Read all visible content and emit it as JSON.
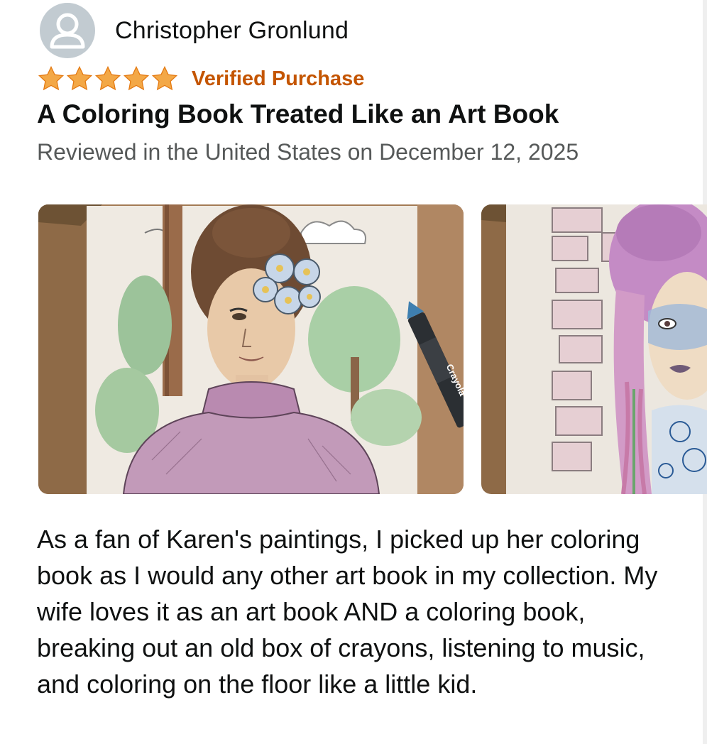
{
  "reviewer": {
    "name": "Christopher Gronlund",
    "avatar_icon": "default-user-icon"
  },
  "rating": {
    "stars": 5,
    "max_stars": 5,
    "star_color": "#f3a847",
    "verified_label": "Verified Purchase",
    "verified_color": "#c45500"
  },
  "review": {
    "title": "A Coloring Book Treated Like an Art Book",
    "date_line": "Reviewed in the United States on December 12, 2025",
    "body": "As a fan of Karen's paintings, I picked up her coloring book as I would any other art book in my collection. My wife loves it as an art book AND a coloring book, breaking out an old box of crayons, listening to music, and coloring on the floor like a little kid."
  },
  "photos": [
    {
      "subject": "colored page: woman with flowers in hair, trees, crayon",
      "crayon_label": "Crayola"
    },
    {
      "subject": "colored page: woman with purple hair, brick wall"
    }
  ]
}
